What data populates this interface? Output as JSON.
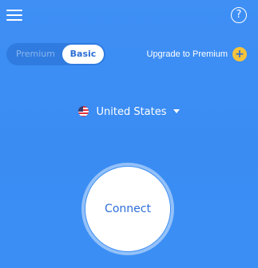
{
  "header": {
    "help_label": "?"
  },
  "plan_toggle": {
    "premium_label": "Premium",
    "basic_label": "Basic",
    "selected": "Basic"
  },
  "upgrade": {
    "label": "Upgrade to Premium",
    "icon_glyph": "+"
  },
  "location": {
    "country": "United States",
    "flag_icon": "us-flag-icon"
  },
  "connect": {
    "label": "Connect"
  },
  "colors": {
    "background": "#3b8ff4",
    "accent": "#2d6ed6",
    "upgrade_icon": "#f5c33b"
  }
}
